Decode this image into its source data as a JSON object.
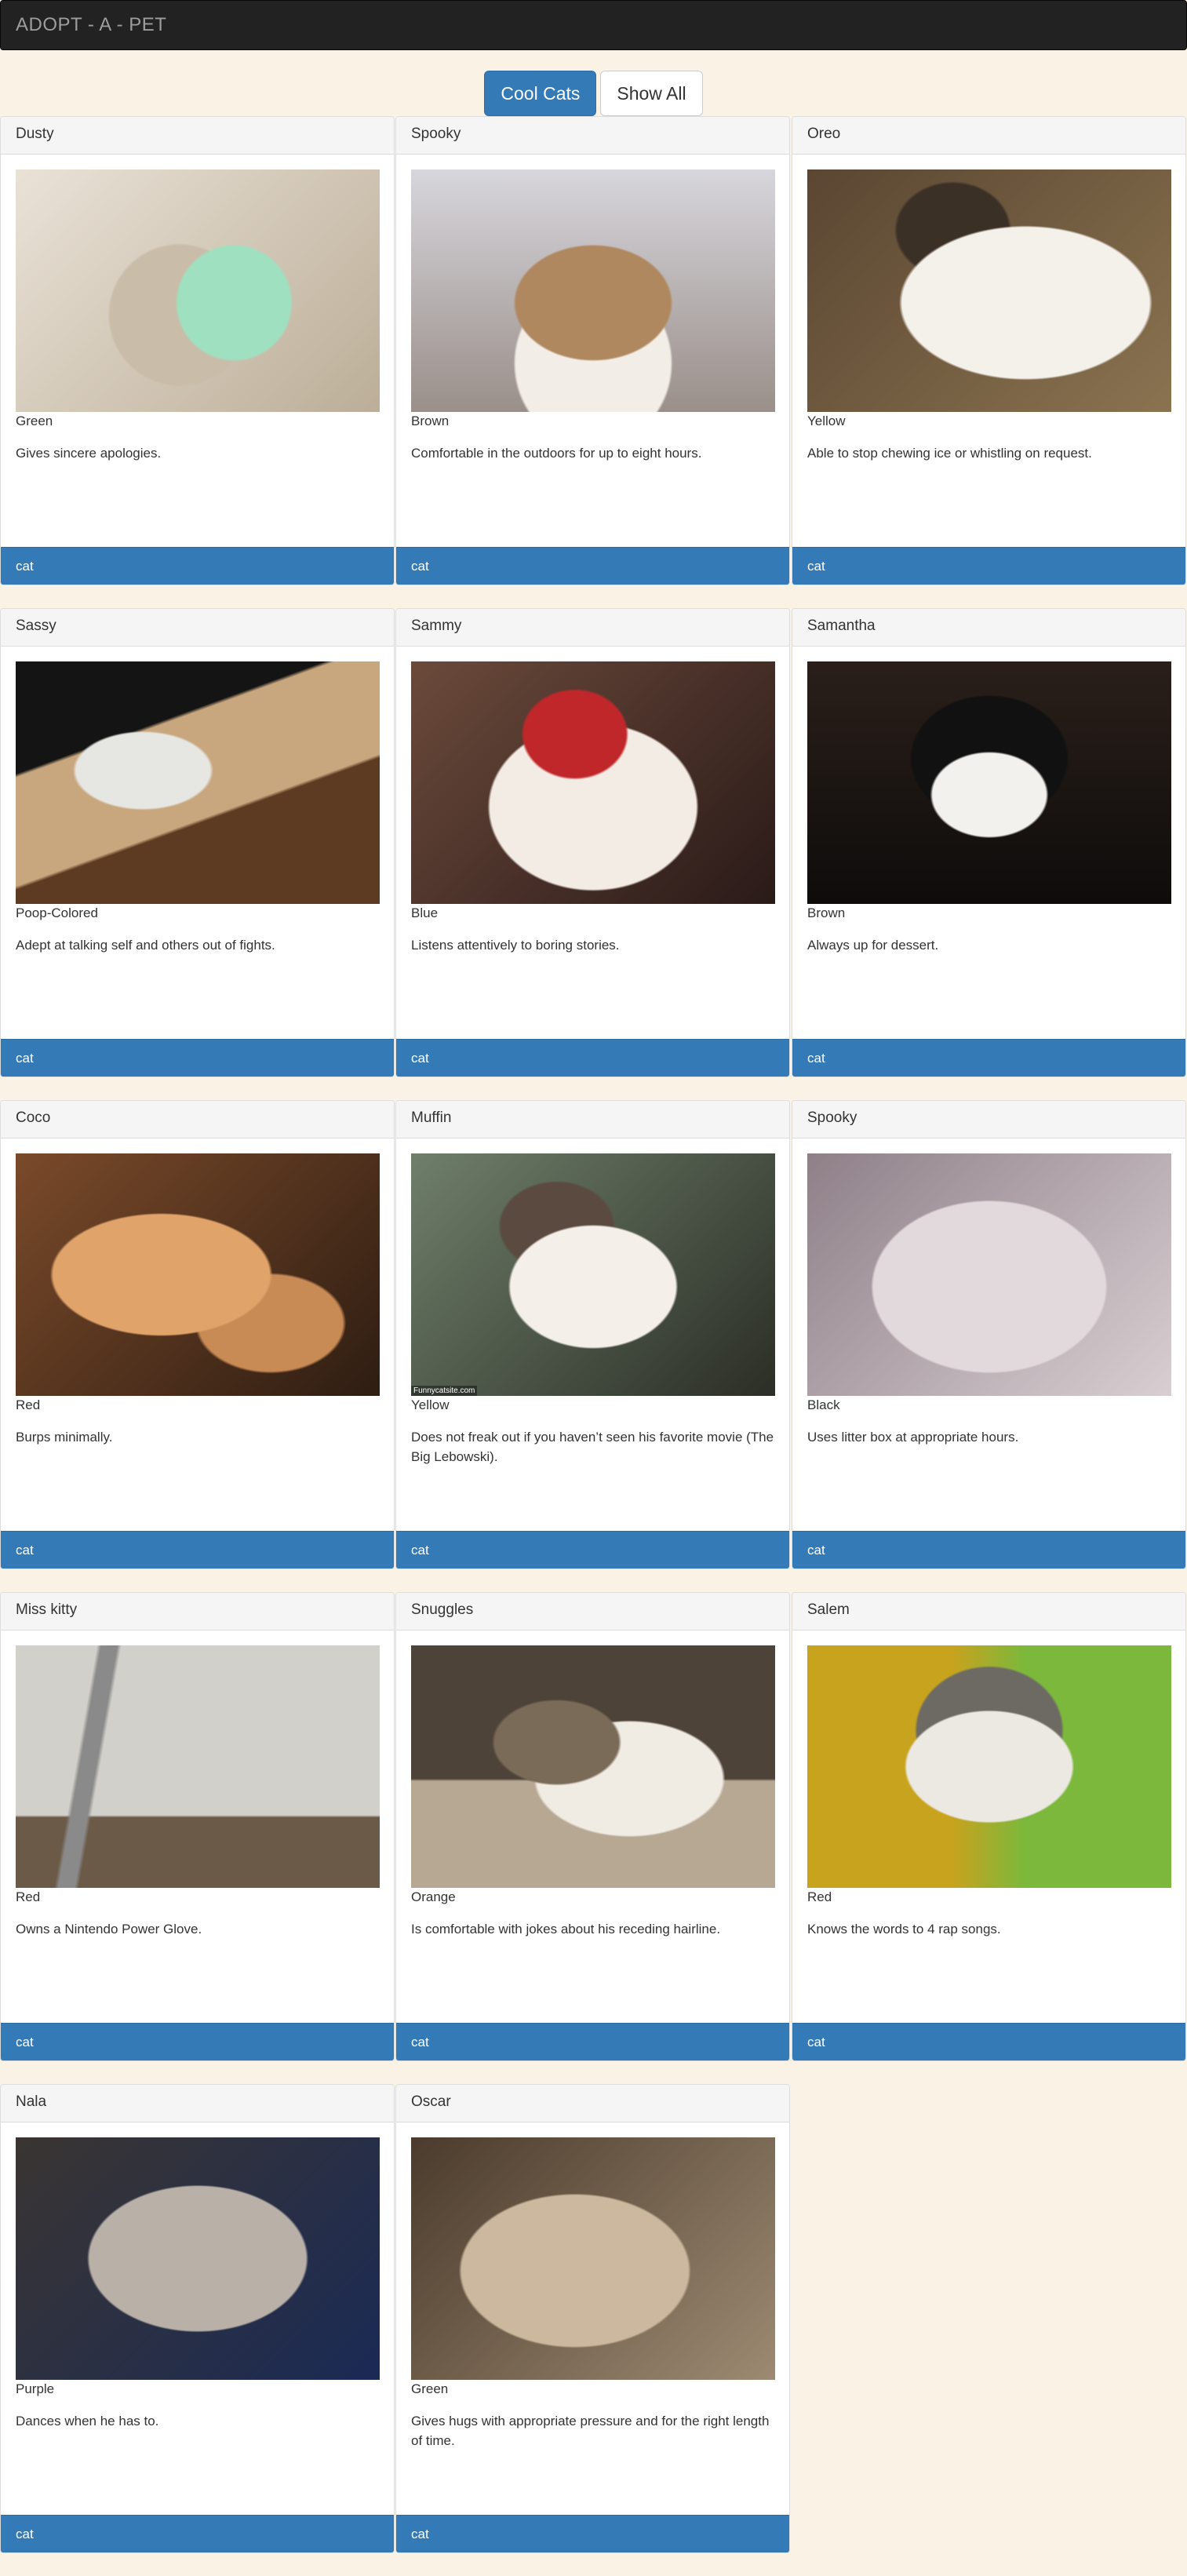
{
  "navbar": {
    "brand": "ADOPT - A - PET"
  },
  "filters": {
    "cool_cats": "Cool Cats",
    "show_all": "Show All"
  },
  "footer_tag": "cat",
  "pets": [
    {
      "name": "Dusty",
      "color": "Green",
      "description": "Gives sincere apologies.",
      "tag": "cat"
    },
    {
      "name": "Spooky",
      "color": "Brown",
      "description": "Comfortable in the outdoors for up to eight hours.",
      "tag": "cat"
    },
    {
      "name": "Oreo",
      "color": "Yellow",
      "description": "Able to stop chewing ice or whistling on request.",
      "tag": "cat"
    },
    {
      "name": "Sassy",
      "color": "Poop-Colored",
      "description": "Adept at talking self and others out of fights.",
      "tag": "cat"
    },
    {
      "name": "Sammy",
      "color": "Blue",
      "description": "Listens attentively to boring stories.",
      "tag": "cat"
    },
    {
      "name": "Samantha",
      "color": "Brown",
      "description": "Always up for dessert.",
      "tag": "cat"
    },
    {
      "name": "Coco",
      "color": "Red",
      "description": "Burps minimally.",
      "tag": "cat"
    },
    {
      "name": "Muffin",
      "color": "Yellow",
      "description": "Does not freak out if you haven’t seen his favorite movie (The Big Lebowski).",
      "tag": "cat",
      "photo_caption": "Funnycatsite.com"
    },
    {
      "name": "Spooky",
      "color": "Black",
      "description": "Uses litter box at appropriate hours.",
      "tag": "cat"
    },
    {
      "name": "Miss kitty",
      "color": "Red",
      "description": "Owns a Nintendo Power Glove.",
      "tag": "cat"
    },
    {
      "name": "Snuggles",
      "color": "Orange",
      "description": "Is comfortable with jokes about his receding hairline.",
      "tag": "cat"
    },
    {
      "name": "Salem",
      "color": "Red",
      "description": "Knows the words to 4 rap songs.",
      "tag": "cat"
    },
    {
      "name": "Nala",
      "color": "Purple",
      "description": "Dances when he has to.",
      "tag": "cat"
    },
    {
      "name": "Oscar",
      "color": "Green",
      "description": "Gives hugs with appropriate pressure and for the right length of time.",
      "tag": "cat"
    }
  ]
}
